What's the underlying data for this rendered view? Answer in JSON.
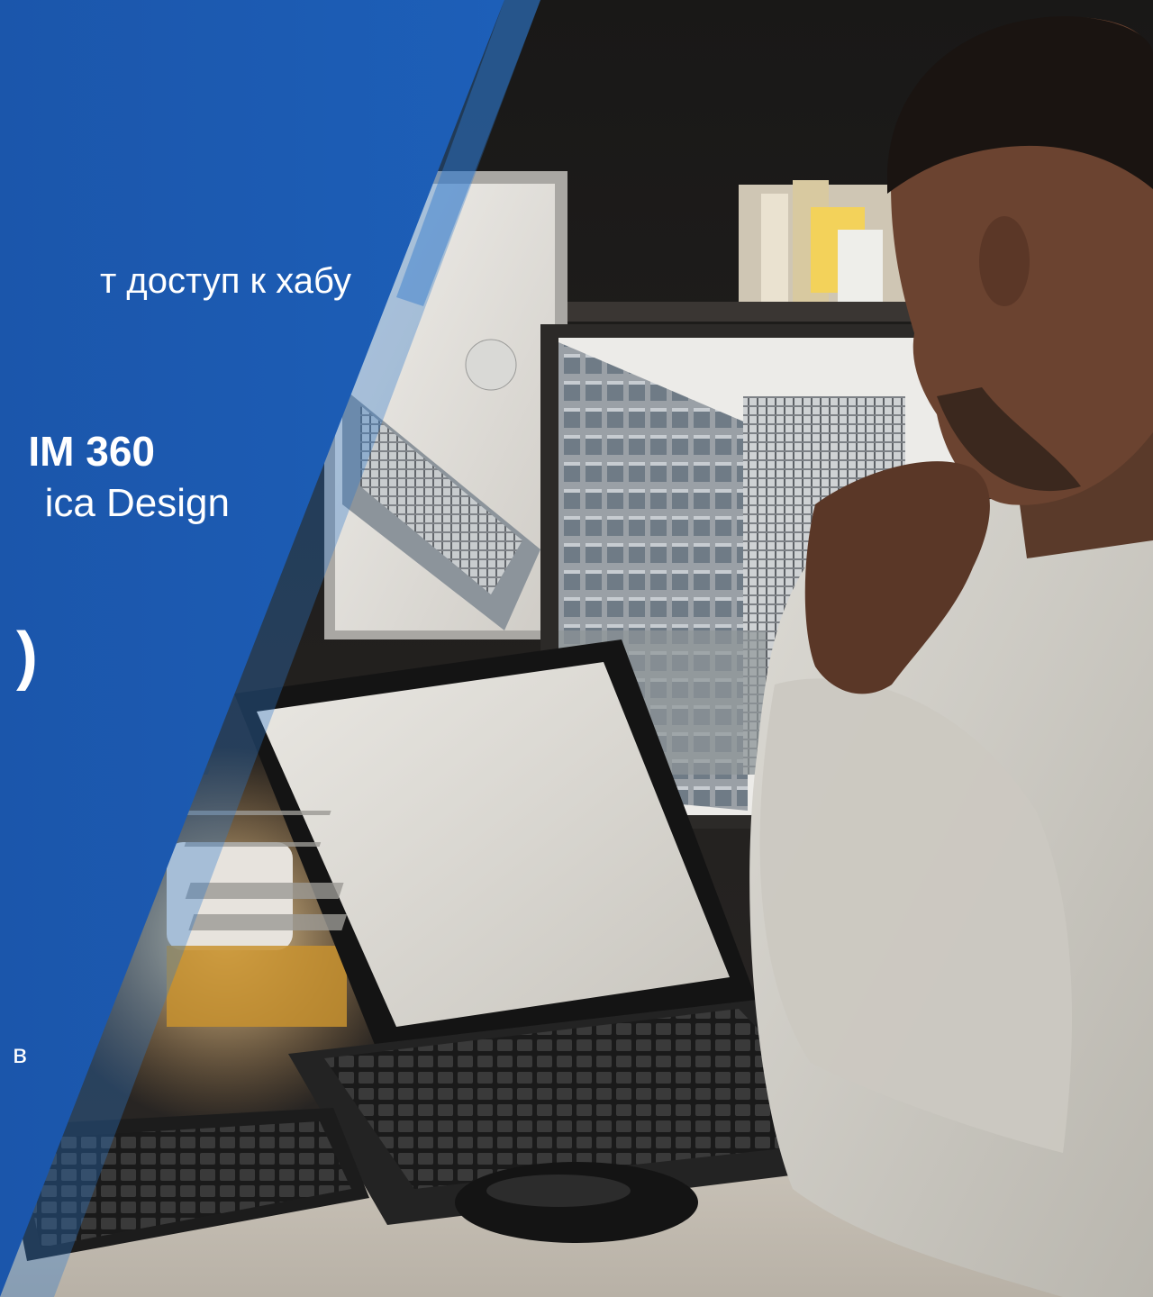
{
  "hero": {
    "line_1": "т доступ к хабу",
    "line_2": "IM 360",
    "line_3": "ica Design",
    "line_4": ")",
    "line_5": "в"
  },
  "colors": {
    "panel_blue": "#1b56ab",
    "panel_edge": "#2f78cc",
    "text": "#ffffff"
  },
  "photo": {
    "subject": "man-at-desk-with-monitors-and-laptop"
  }
}
